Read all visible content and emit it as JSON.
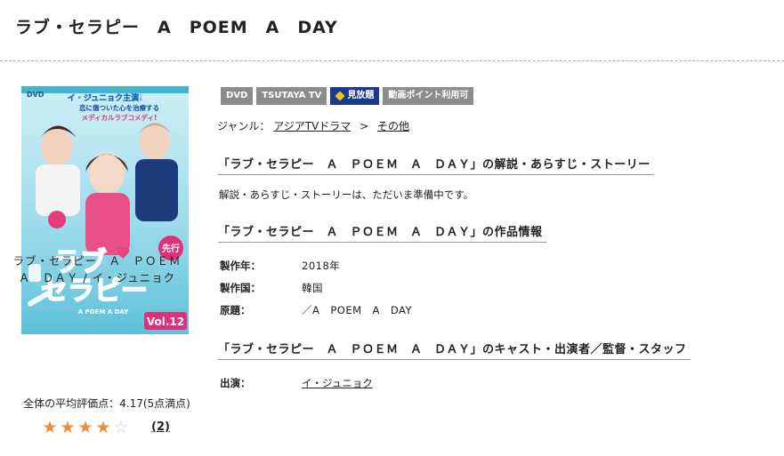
{
  "page": {
    "title": "ラブ・セラピー　A　POEM　A　DAY"
  },
  "cover": {
    "top_text_1": "イ・ジュニョク主演!",
    "top_text_2": "恋に傷ついた心を治療する",
    "top_text_3": "メディカルラブコメディ!",
    "logo_1": "ラブ",
    "logo_2": "セラピー",
    "logo_sub": "A POEM A DAY",
    "volume": "Vol.12",
    "tag": "先行"
  },
  "product": {
    "title": "ラブ・セラピー　Ａ　ＰＯＥＭ　Ａ　ＤＡＹ / イ・ジュニョク",
    "rating_text": "全体の平均評価点：4.17(5点満点)",
    "rating_value": 4.17,
    "review_count": "(2)"
  },
  "badges": [
    "DVD",
    "TSUTAYA TV",
    "見放題",
    "動画ポイント利用可"
  ],
  "genre": {
    "label": "ジャンル：",
    "items": [
      "アジアTVドラマ",
      "その他"
    ],
    "separator": ">"
  },
  "sections": {
    "synopsis_heading": "「ラブ・セラピー　Ａ　ＰＯＥＭ　Ａ　ＤＡＹ」の解説・あらすじ・ストーリー",
    "synopsis_text": "解説・あらすじ・ストーリーは、ただいま準備中です。",
    "info_heading": "「ラブ・セラピー　Ａ　ＰＯＥＭ　Ａ　ＤＡＹ」の作品情報",
    "info": [
      {
        "label": "製作年：",
        "value": "2018年"
      },
      {
        "label": "製作国：",
        "value": "韓国"
      },
      {
        "label": "原題：",
        "value": "／A　POEM　A　DAY"
      }
    ],
    "cast_heading": "「ラブ・セラピー　Ａ　ＰＯＥＭ　Ａ　ＤＡＹ」のキャスト・出演者／監督・スタッフ",
    "cast": [
      {
        "label": "出演：",
        "value": "イ・ジュニョク"
      }
    ]
  },
  "colors": {
    "star": "#f08a3a",
    "badge_gray": "#8c8c8c",
    "badge_navy": "#1c3a8c"
  }
}
